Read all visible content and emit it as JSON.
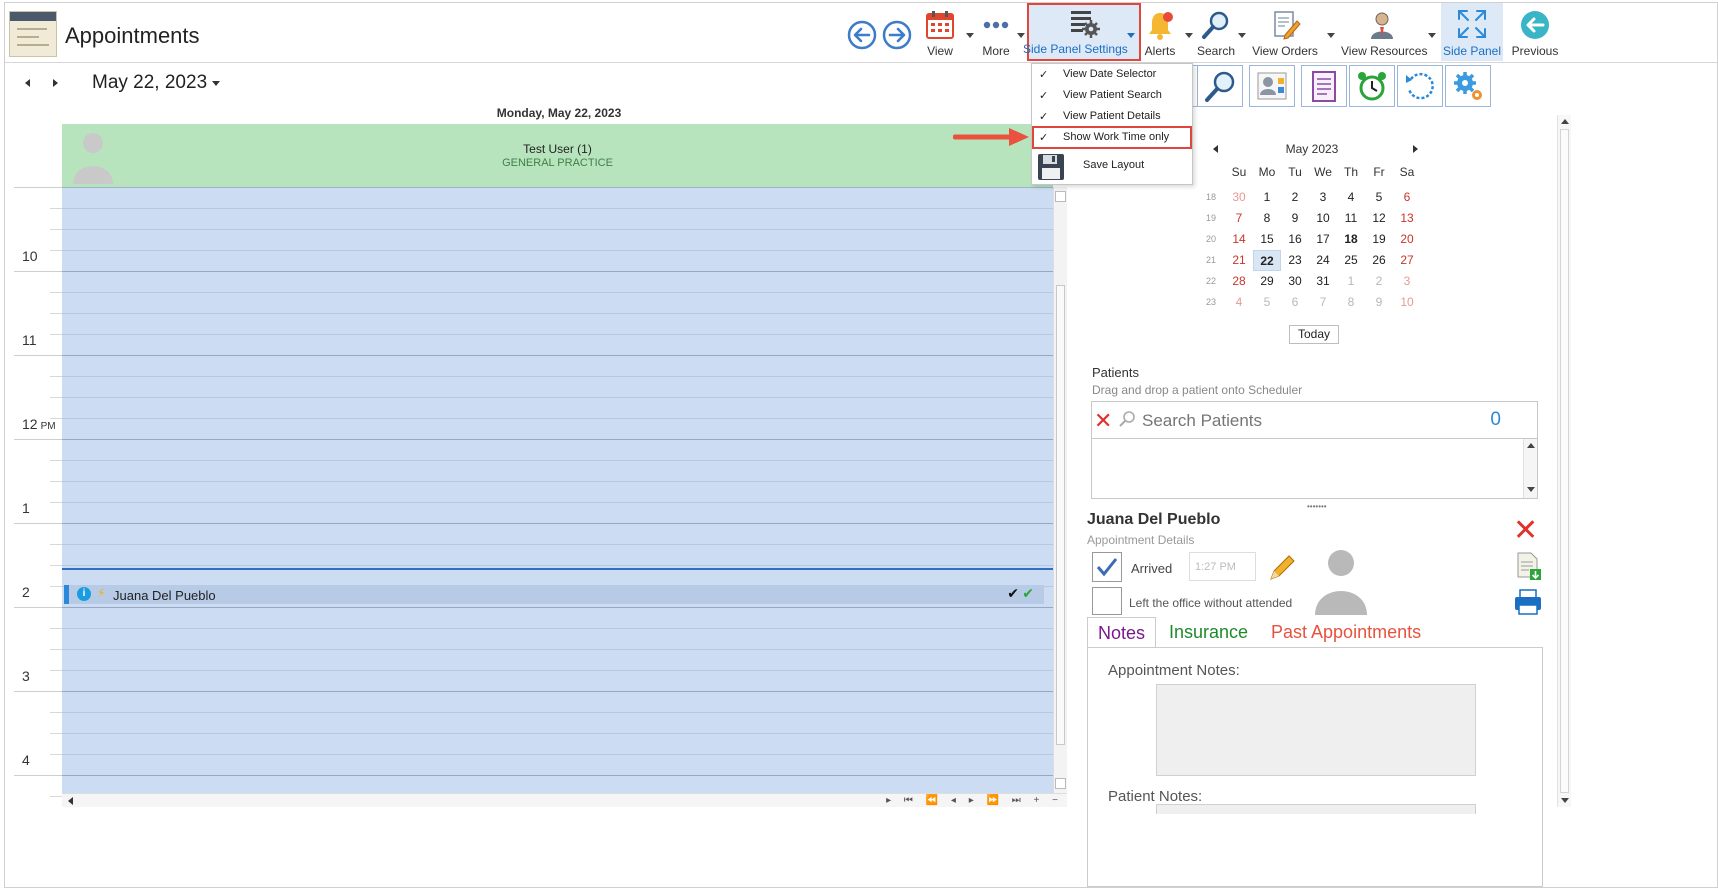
{
  "window": {
    "title": "Appointments"
  },
  "toolbar": {
    "view_label": "View",
    "more_label": "More",
    "side_panel_settings_label": "Side Panel Settings",
    "alerts_label": "Alerts",
    "search_label": "Search",
    "view_orders_label": "View Orders",
    "view_resources_label": "View Resources",
    "side_panel_label": "Side Panel",
    "previous_label": "Previous"
  },
  "date_nav": {
    "current_date": "May 22, 2023",
    "day_header": "Monday, May 22, 2023"
  },
  "resource": {
    "name": "Test User (1)",
    "department": "GENERAL PRACTICE"
  },
  "time_ruler": {
    "hours": [
      "10",
      "11",
      "12",
      "1",
      "2",
      "3",
      "4"
    ],
    "pm_suffix": "PM"
  },
  "appointment": {
    "patient_name": "Juana Del Pueblo"
  },
  "dropdown_menu": {
    "items": [
      {
        "label": "View Date Selector",
        "checked": "✓"
      },
      {
        "label": "View Patient Search",
        "checked": "✓"
      },
      {
        "label": "View Patient Details",
        "checked": "✓"
      },
      {
        "label": "Show Work Time only",
        "checked": "✓"
      }
    ],
    "save_layout_label": "Save Layout"
  },
  "calendar": {
    "title": "May 2023",
    "days_of_week": [
      "Su",
      "Mo",
      "Tu",
      "We",
      "Th",
      "Fr",
      "Sa"
    ],
    "weeks": [
      {
        "week": "18",
        "days": [
          "30",
          "1",
          "2",
          "3",
          "4",
          "5",
          "6"
        ]
      },
      {
        "week": "19",
        "days": [
          "7",
          "8",
          "9",
          "10",
          "11",
          "12",
          "13"
        ]
      },
      {
        "week": "20",
        "days": [
          "14",
          "15",
          "16",
          "17",
          "18",
          "19",
          "20"
        ]
      },
      {
        "week": "21",
        "days": [
          "21",
          "22",
          "23",
          "24",
          "25",
          "26",
          "27"
        ]
      },
      {
        "week": "22",
        "days": [
          "28",
          "29",
          "30",
          "31",
          "1",
          "2",
          "3"
        ]
      },
      {
        "week": "23",
        "days": [
          "4",
          "5",
          "6",
          "7",
          "8",
          "9",
          "10"
        ]
      }
    ],
    "selected_day": "22",
    "today_label": "Today"
  },
  "patients": {
    "title": "Patients",
    "hint": "Drag and drop a patient onto Scheduler",
    "search_placeholder": "Search Patients",
    "count": "0"
  },
  "details": {
    "patient_name": "Juana Del Pueblo",
    "subtitle": "Appointment Details",
    "arrived_label": "Arrived",
    "arrived_time": "1:27 PM",
    "left_label": "Left the office without attended",
    "tabs": [
      "Notes",
      "Insurance",
      "Past Appointments"
    ],
    "appointment_notes_label": "Appointment Notes:",
    "patient_notes_label": "Patient Notes:"
  },
  "colors": {
    "accent": "#2a8ad9",
    "highlight_border": "#e0473c",
    "resource_header": "#b8e4bd",
    "schedule_bg": "#ccdcf3"
  }
}
